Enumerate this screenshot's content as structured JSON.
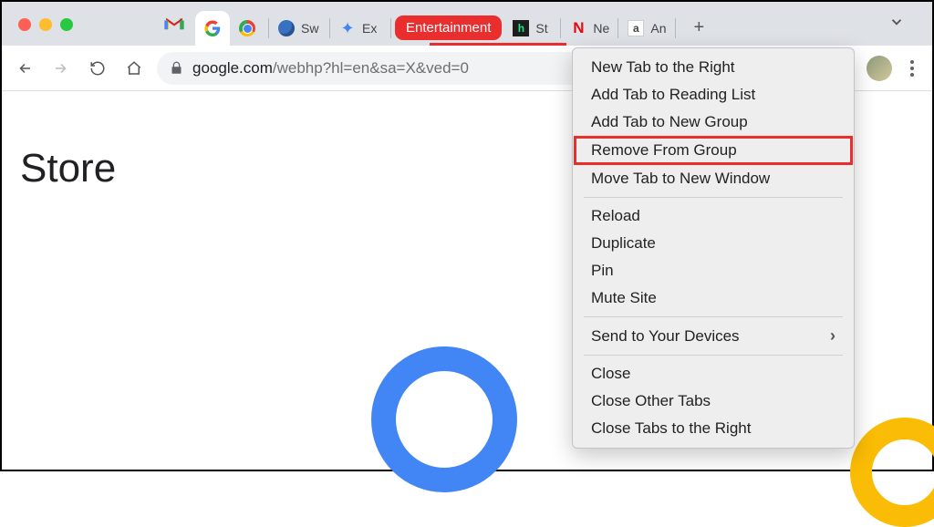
{
  "tabs": [
    {
      "label": ""
    },
    {
      "label": "Sw"
    },
    {
      "label": "Ex"
    },
    {
      "label": "St"
    },
    {
      "label": "Ne"
    },
    {
      "label": "An"
    }
  ],
  "tab_group": {
    "label": "Entertainment",
    "color": "#ea2d2d"
  },
  "toolbar": {
    "url_host": "google.com",
    "url_path": "/webhp?hl=en&sa=X&ved=0"
  },
  "page": {
    "store_label": "Store"
  },
  "context_menu": {
    "items": [
      {
        "label": "New Tab to the Right"
      },
      {
        "label": "Add Tab to Reading List"
      },
      {
        "label": "Add Tab to New Group"
      },
      {
        "label": "Remove From Group",
        "highlighted": true
      },
      {
        "label": "Move Tab to New Window"
      }
    ],
    "items2": [
      {
        "label": "Reload"
      },
      {
        "label": "Duplicate"
      },
      {
        "label": "Pin"
      },
      {
        "label": "Mute Site"
      }
    ],
    "items3": [
      {
        "label": "Send to Your Devices",
        "submenu": true
      }
    ],
    "items4": [
      {
        "label": "Close"
      },
      {
        "label": "Close Other Tabs"
      },
      {
        "label": "Close Tabs to the Right"
      }
    ]
  }
}
